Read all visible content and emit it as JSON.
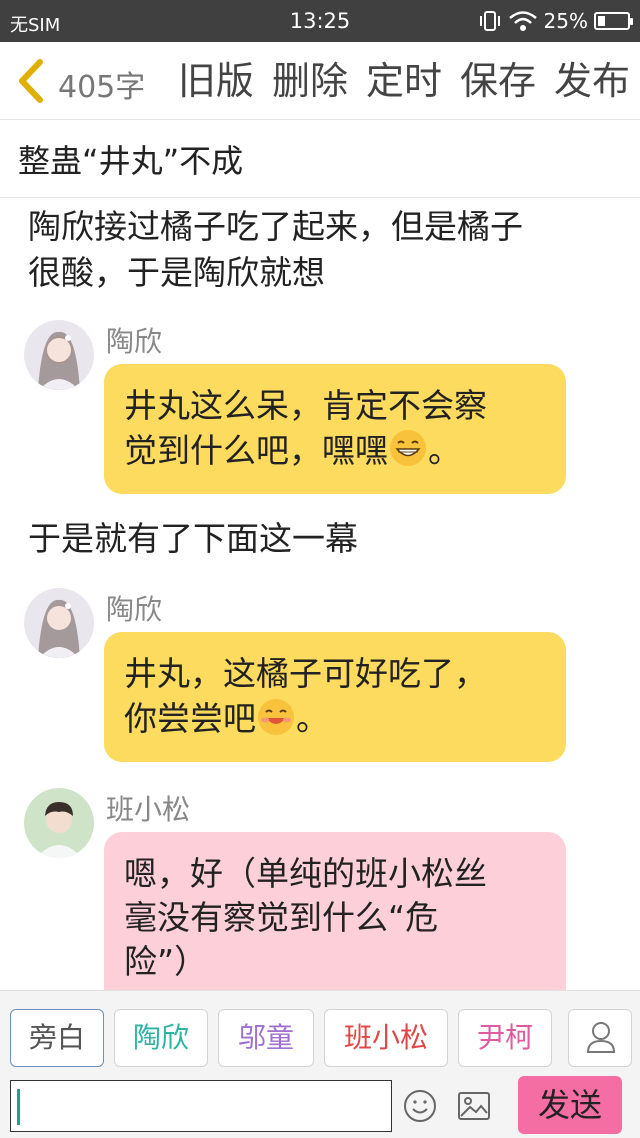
{
  "status_bar": {
    "carrier": "无SIM",
    "time": "13:25",
    "battery": "25%",
    "battery_level": 0.25
  },
  "toolbar": {
    "word_count": "405字",
    "actions": [
      "旧版",
      "删除",
      "定时",
      "保存",
      "发布"
    ]
  },
  "title": "整蛊“井丸”不成",
  "messages": {
    "narration_1": {
      "line1": "陶欣接过橘子吃了起来，但是橘子",
      "line2": "很酸，于是陶欣就想"
    },
    "msg_1": {
      "name": "陶欣",
      "line1": "井丸这么呆，肯定不会察",
      "line2": "觉到什么吧，嘿嘿",
      "tail": "。"
    },
    "narration_2": "于是就有了下面这一幕",
    "msg_2": {
      "name": "陶欣",
      "line1": "井丸，这橘子可好吃了，",
      "line2": "你尝尝吧",
      "tail": "。"
    },
    "msg_3": {
      "name": "班小松",
      "line1": "嗯，好（单纯的班小松丝",
      "line2": "毫没有察觉到什么“危",
      "line3": "险”）"
    }
  },
  "characters": [
    {
      "label": "旁白",
      "color": "#555555"
    },
    {
      "label": "陶欣",
      "color": "#2bb5a3"
    },
    {
      "label": "邬童",
      "color": "#a06fd0"
    },
    {
      "label": "班小松",
      "color": "#e04848"
    },
    {
      "label": "尹柯",
      "color": "#e05aa0"
    }
  ],
  "composer": {
    "send_label": "发送",
    "colors": {
      "send_bg": "#f46ea3",
      "bubble_a": "#fcdb5e",
      "bubble_b": "#fdcfd9"
    }
  }
}
